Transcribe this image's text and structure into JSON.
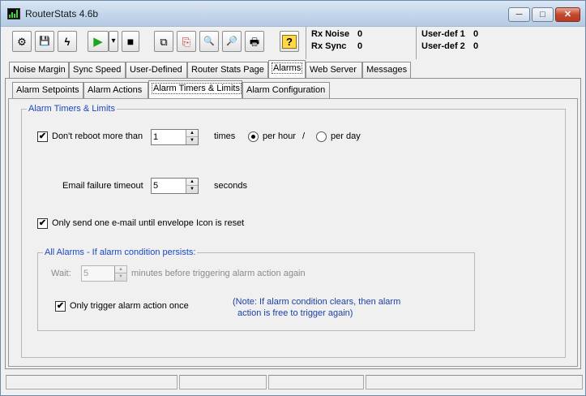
{
  "window": {
    "title": "RouterStats 4.6b",
    "controls": {
      "minimize": "─",
      "maximize": "□",
      "close": "✕"
    }
  },
  "toolbar": {
    "buttons": [
      {
        "icon": "router-settings-icon",
        "glyph": "⚙"
      },
      {
        "icon": "save-disk-icon",
        "glyph": "💾"
      },
      {
        "icon": "lightning-icon",
        "glyph": "ϟ"
      },
      {
        "icon": "play-icon",
        "glyph": "▶"
      },
      {
        "icon": "dropdown-arrow-icon",
        "glyph": "▾"
      },
      {
        "icon": "stop-icon",
        "glyph": "■"
      },
      {
        "icon": "copy-icon",
        "glyph": "⧉"
      },
      {
        "icon": "paste-icon",
        "glyph": "⎘"
      },
      {
        "icon": "zoom-page-icon",
        "glyph": "🔍"
      },
      {
        "icon": "zoom-page-alt-icon",
        "glyph": "🔎"
      },
      {
        "icon": "print-preview-icon",
        "glyph": "🖶"
      },
      {
        "icon": "help-icon",
        "glyph": "?"
      }
    ],
    "accent_play": "#1fa51f"
  },
  "stats": {
    "rx_noise_label": "Rx Noise",
    "rx_noise_value": "0",
    "rx_sync_label": "Rx Sync",
    "rx_sync_value": "0",
    "user_def1_label": "User-def 1",
    "user_def1_value": "0",
    "user_def2_label": "User-def 2",
    "user_def2_value": "0"
  },
  "main_tabs": [
    {
      "label": "Noise Margin"
    },
    {
      "label": "Sync Speed"
    },
    {
      "label": "User-Defined"
    },
    {
      "label": "Router Stats Page"
    },
    {
      "label": "Alarms",
      "active": true
    },
    {
      "label": "Web Server"
    },
    {
      "label": "Messages"
    }
  ],
  "sub_tabs": [
    {
      "label": "Alarm Setpoints"
    },
    {
      "label": "Alarm Actions"
    },
    {
      "label": "Alarm Timers & Limits",
      "active": true
    },
    {
      "label": "Alarm Configuration"
    }
  ],
  "timers": {
    "group_title": "Alarm Timers & Limits",
    "reboot_check_label": "Don't reboot more than",
    "reboot_checked": true,
    "reboot_count": "1",
    "times_label": "times",
    "per_hour_label": "per hour",
    "per_hour_selected": true,
    "slash": "/",
    "per_day_label": "per day",
    "per_day_selected": false,
    "email_timeout_label": "Email failure timeout",
    "email_timeout_value": "5",
    "seconds_label": "seconds",
    "one_email_label": "Only send one e-mail until envelope Icon is reset",
    "one_email_checked": true
  },
  "all_alarms": {
    "group_title": "All Alarms  - If alarm condition persists:",
    "wait_label": "Wait:",
    "wait_value": "5",
    "minutes_label": "minutes before triggering alarm action again",
    "once_label": "Only trigger alarm action once",
    "once_checked": true,
    "note_line1": "(Note: If alarm condition clears, then alarm",
    "note_line2": "action is free to trigger again)"
  },
  "colors": {
    "group_title": "#1b47c2",
    "note_text": "#1b3fa8",
    "titlebar": "#c2d5ea"
  },
  "check_glyph": "✔"
}
